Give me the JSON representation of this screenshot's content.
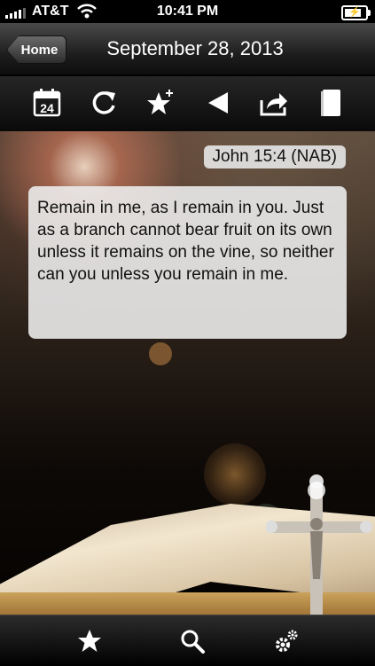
{
  "status": {
    "carrier": "AT&T",
    "time": "10:41 PM"
  },
  "nav": {
    "home_label": "Home",
    "title": "September 28, 2013"
  },
  "toolbar": {
    "calendar_day": "24"
  },
  "verse": {
    "reference": "John 15:4 (NAB)",
    "text": "Remain in me, as I remain in you. Just as a branch cannot bear fruit on its own unless it remains on the vine, so neither can you unless you remain in me."
  },
  "icons": [
    "signal-icon",
    "wifi-icon",
    "battery-icon",
    "calendar-icon",
    "refresh-icon",
    "add-favorite-icon",
    "play-back-icon",
    "share-icon",
    "book-icon",
    "favorites-tab-icon",
    "search-tab-icon",
    "settings-tab-icon"
  ],
  "colors": {
    "text_box": "#ebebeb",
    "accent": "#ffffff"
  }
}
